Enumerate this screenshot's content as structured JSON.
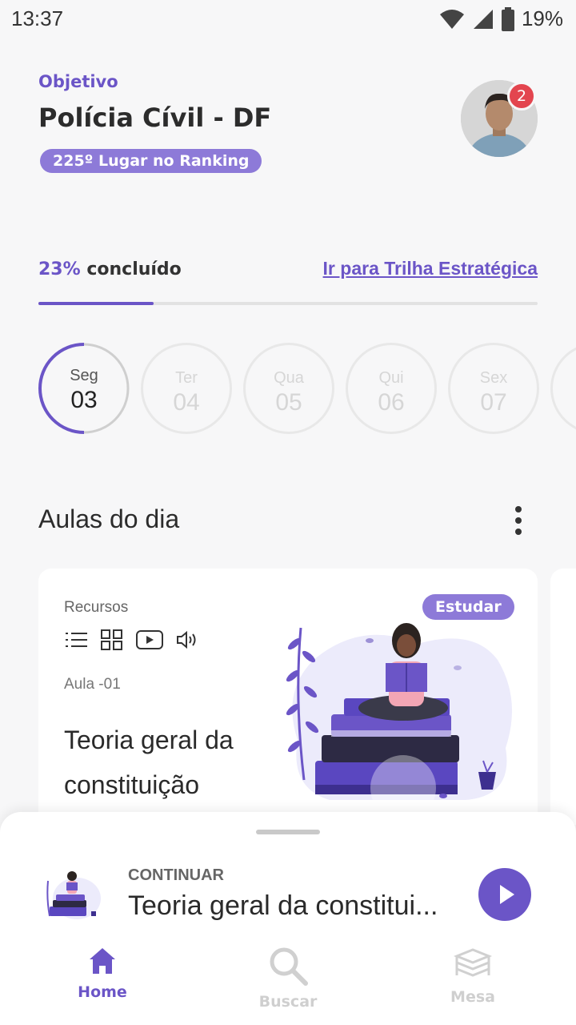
{
  "status_bar": {
    "time": "13:37",
    "battery": "19%"
  },
  "header": {
    "objective_label": "Objetivo",
    "objective_title": "Polícia Cívil - DF",
    "ranking": "225º Lugar no Ranking",
    "notifications": "2"
  },
  "progress": {
    "percent_label": "23%",
    "suffix": " concluído",
    "fraction": 0.23,
    "link": "Ir para Trilha Estratégica"
  },
  "days": [
    {
      "name": "Seg",
      "num": "03",
      "active": true
    },
    {
      "name": "Ter",
      "num": "04"
    },
    {
      "name": "Qua",
      "num": "05"
    },
    {
      "name": "Qui",
      "num": "06"
    },
    {
      "name": "Sex",
      "num": "07"
    }
  ],
  "lessons": {
    "section_title": "Aulas do dia",
    "card": {
      "resources_label": "Recursos",
      "resource_icons": [
        "list-icon",
        "grid-icon",
        "video-icon",
        "audio-icon"
      ],
      "study_badge": "Estudar",
      "lesson_number": "Aula -01",
      "title": "Teoria geral da constituição"
    }
  },
  "continue": {
    "label": "CONTINUAR",
    "title": "Teoria geral da constitui..."
  },
  "nav": [
    {
      "label": "Home",
      "icon": "home-icon",
      "active": true
    },
    {
      "label": "Buscar",
      "icon": "search-icon"
    },
    {
      "label": "Mesa",
      "icon": "books-icon"
    }
  ],
  "colors": {
    "accent": "#6b55c7",
    "badge": "#8d7ad8",
    "notification": "#e3454f"
  }
}
